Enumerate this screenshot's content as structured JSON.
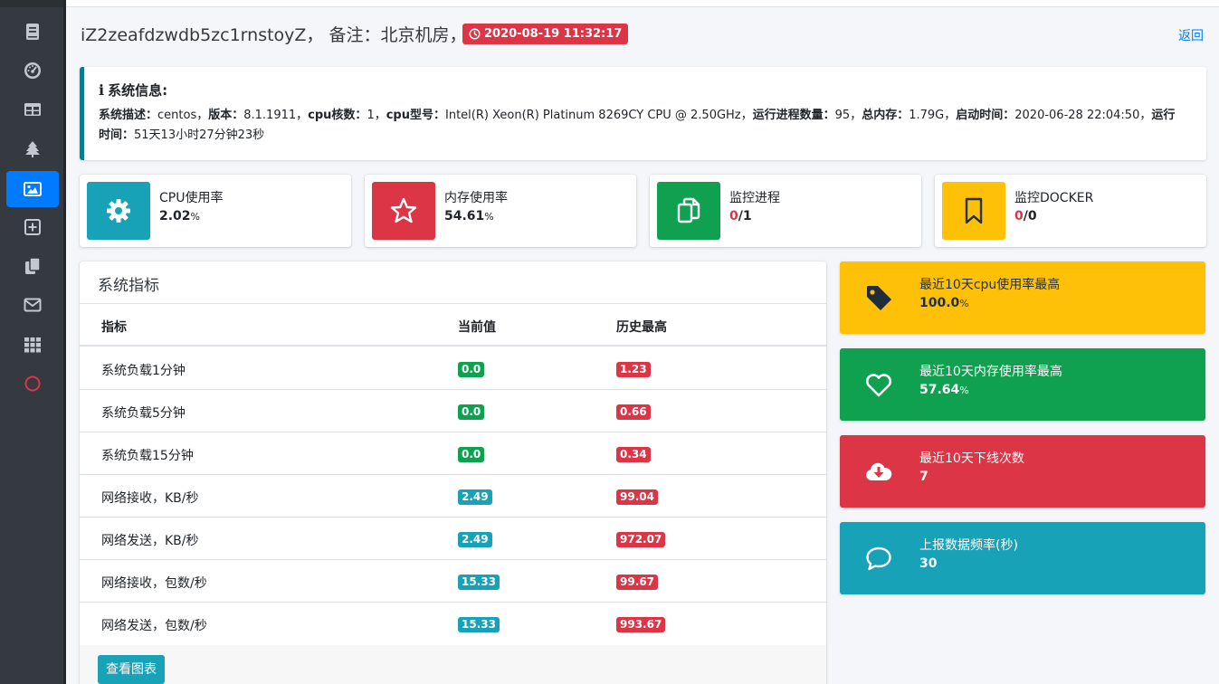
{
  "sidebar": {
    "items": [
      {
        "icon": "book-icon",
        "active": false
      },
      {
        "icon": "tachometer-icon",
        "active": false
      },
      {
        "icon": "table-icon",
        "active": false
      },
      {
        "icon": "tree-icon",
        "active": false
      },
      {
        "icon": "image-icon",
        "active": true
      },
      {
        "icon": "plus-square-icon",
        "active": false
      },
      {
        "icon": "copy-icon",
        "active": false
      },
      {
        "icon": "envelope-icon",
        "active": false
      },
      {
        "icon": "th-icon",
        "active": false
      },
      {
        "icon": "circle-icon",
        "active": false
      }
    ]
  },
  "header": {
    "title": "iZ2zeafdzwdb5zc1rnstoyZ， 备注：北京机房，",
    "time": "2020-08-19 11:32:17",
    "back": "返回"
  },
  "system_info": {
    "title": "系统信息:",
    "desc_label": "系统描述：",
    "desc_value": "centos，",
    "version_label": "版本：",
    "version_value": "8.1.1911，",
    "cores_label": "cpu核数：",
    "cores_value": "1，",
    "cpu_model_label": "cpu型号：",
    "cpu_model_value": "Intel(R) Xeon(R) Platinum 8269CY CPU @ 2.50GHz，",
    "proc_count_label": "运行进程数量：",
    "proc_count_value": "95，",
    "mem_total_label": "总内存：",
    "mem_total_value": "1.79G，",
    "boot_label": "启动时间：",
    "boot_value": "2020-06-28 22:04:50，",
    "uptime_label": "运行时间：",
    "uptime_value": "51天13小时27分钟23秒"
  },
  "stats": {
    "cpu": {
      "label": "CPU使用率",
      "value": "2.02",
      "unit": "%"
    },
    "mem": {
      "label": "内存使用率",
      "value": "54.61",
      "unit": "%"
    },
    "proc": {
      "label": "监控进程",
      "value_a": "0",
      "value_b": "/1"
    },
    "docker": {
      "label": "监控DOCKER",
      "value_a": "0",
      "value_b": "/0"
    }
  },
  "metrics": {
    "title": "系统指标",
    "headers": {
      "name": "指标",
      "current": "当前值",
      "max": "历史最高"
    },
    "rows": [
      {
        "name": "系统负载1分钟",
        "current": "0.0",
        "max": "1.23"
      },
      {
        "name": "系统负载5分钟",
        "current": "0.0",
        "max": "0.66"
      },
      {
        "name": "系统负载15分钟",
        "current": "0.0",
        "max": "0.34"
      },
      {
        "name": "网络接收，KB/秒",
        "current": "2.49",
        "max": "99.04"
      },
      {
        "name": "网络发送，KB/秒",
        "current": "2.49",
        "max": "972.07"
      },
      {
        "name": "网络接收，包数/秒",
        "current": "15.33",
        "max": "99.67"
      },
      {
        "name": "网络发送，包数/秒",
        "current": "15.33",
        "max": "993.67"
      }
    ],
    "button": "查看图表"
  },
  "summary": {
    "cpu_max": {
      "label": "最近10天cpu使用率最高",
      "value": "100.0",
      "unit": "%"
    },
    "mem_max": {
      "label": "最近10天内存使用率最高",
      "value": "57.64",
      "unit": "%"
    },
    "offline": {
      "label": "最近10天下线次数",
      "value": "7"
    },
    "freq": {
      "label": "上报数据频率(秒)",
      "value": "30"
    }
  },
  "colors": {
    "teal": "#17a2b8",
    "red": "#dc3545",
    "green": "#0fa150",
    "yellow": "#ffc107",
    "blue": "#007bff",
    "sidebar": "#343a40"
  }
}
